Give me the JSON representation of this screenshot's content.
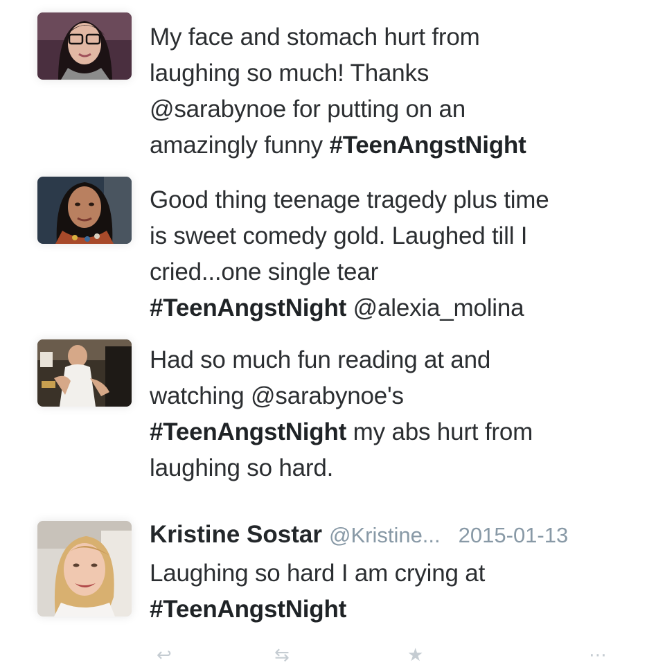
{
  "tweets": [
    {
      "avatar_icon": "user-avatar-photo",
      "lines": [
        [
          {
            "t": "My face and stomach hurt from"
          }
        ],
        [
          {
            "t": "laughing so much! Thanks"
          }
        ],
        [
          {
            "t": "@sarabynoe for putting on an"
          }
        ],
        [
          {
            "t": "amazingly funny "
          },
          {
            "t": "#TeenAngstNight",
            "b": true
          }
        ]
      ]
    },
    {
      "avatar_icon": "user-avatar-photo",
      "lines": [
        [
          {
            "t": "Good thing teenage tragedy plus time"
          }
        ],
        [
          {
            "t": "is sweet comedy gold. Laughed till I"
          }
        ],
        [
          {
            "t": "cried...one single tear"
          }
        ],
        [
          {
            "t": "#TeenAngstNight",
            "b": true
          },
          {
            "t": " @alexia_molina"
          }
        ]
      ]
    },
    {
      "avatar_icon": "user-avatar-photo",
      "lines": [
        [
          {
            "t": "Had so much fun reading at and"
          }
        ],
        [
          {
            "t": "watching @sarabynoe's"
          }
        ],
        [
          {
            "t": "#TeenAngstNight",
            "b": true
          },
          {
            "t": " my abs hurt from"
          }
        ],
        [
          {
            "t": "laughing so hard."
          }
        ]
      ]
    },
    {
      "avatar_icon": "user-avatar-photo",
      "name": "Kristine Sostar",
      "handle": "@Kristine...",
      "date": "2015-01-13",
      "lines": [
        [
          {
            "t": "Laughing so hard I am crying at"
          }
        ],
        [
          {
            "t": "#TeenAngstNight",
            "b": true
          }
        ]
      ]
    }
  ],
  "actions": [
    {
      "icon": "reply-icon"
    },
    {
      "icon": "retweet-icon"
    },
    {
      "icon": "favorite-icon"
    },
    {
      "icon": "more-icon"
    }
  ]
}
